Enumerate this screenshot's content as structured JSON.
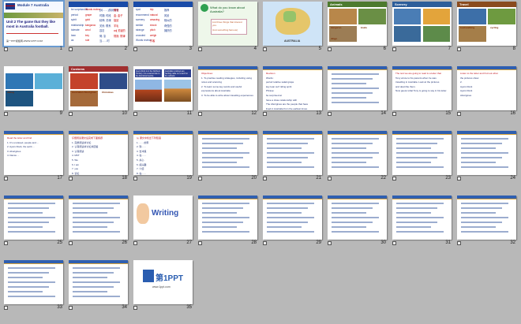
{
  "colors": {
    "background": "#b8b8b8",
    "selection": "#6a9ad0"
  },
  "slides": [
    {
      "num": "1",
      "theme": "cover",
      "title": "Unit 2  The game that they like most in Australia football.",
      "subtitle": "Module 7  Australia",
      "footer": "第一PPT模板网-WWW.1PPT.COM"
    },
    {
      "num": "2",
      "theme": "words",
      "lines": [
        "be surprised at",
        "period",
        "spirit",
        "relationship",
        "tolerate",
        "lean",
        "as",
        "Words review",
        "grape",
        "gold",
        "kangaroo",
        "wool",
        "key",
        "rule",
        "(对……)感到惊讶",
        "时期; 时段",
        "精神; 灵魂",
        "关系; 联系",
        "容忍",
        "倚; 靠",
        "当……时",
        "葡萄",
        "金; 金子",
        "袋鼠",
        "羊毛",
        "adj 关键的",
        "规则; 规律"
      ]
    },
    {
      "num": "3",
      "theme": "words",
      "lines": [
        "spot",
        "recommend",
        "scenery",
        "similar",
        "strange",
        "crowded",
        "Words review",
        "trip",
        "natural",
        "amazing",
        "shock",
        "pitch",
        "weigh",
        "作客",
        "推荐",
        "风景",
        "相似的",
        "奇怪的",
        "拥挤的"
      ]
    },
    {
      "num": "4",
      "theme": "ask",
      "lines": [
        "What do you know about Australia?",
        "List three things that interest you.",
        "(List something famous)"
      ]
    },
    {
      "num": "5",
      "theme": "map",
      "lines": [
        "AUSTRALIA"
      ]
    },
    {
      "num": "6",
      "theme": "photos",
      "lines": [
        "Animals",
        "kangaroo",
        "koala",
        "dingo"
      ]
    },
    {
      "num": "7",
      "theme": "photos",
      "lines": [
        "Scenery"
      ]
    },
    {
      "num": "8",
      "theme": "photos",
      "lines": [
        "Travel",
        "bushwalking",
        "cycling"
      ]
    },
    {
      "num": "9",
      "theme": "photos",
      "lines": [
        "surfing",
        "diving"
      ]
    },
    {
      "num": "10",
      "theme": "photos",
      "lines": [
        "Customs",
        "Australian Aborigines",
        "Christmas"
      ]
    },
    {
      "num": "11",
      "theme": "ayers",
      "lines": [
        "Ayers Rock is in the Northern Territory. It is a sacred site to the Aboriginal people.",
        "Australian cowboys are herding cattle on a ranch in the outback."
      ]
    },
    {
      "num": "12",
      "theme": "textbox",
      "lines": [
        "Objectives:",
        "1. To practise reading strategies, including using",
        "notes and scanning",
        "2. To learn some key words and useful",
        "expressions about Australia",
        "3. To be able to write about travelling experiences"
      ]
    },
    {
      "num": "13",
      "theme": "textbox",
      "lines": [
        "Revision",
        "Words:",
        "period  relative  salad  grape",
        "key   lean   surf  riding  spirit",
        "Phrase:",
        "be surprised at",
        "have a close relationship with",
        "The Aborigines are the people that have",
        "lived in Australia from the earliest times."
      ]
    },
    {
      "num": "14",
      "theme": "textbox",
      "lines": []
    },
    {
      "num": "15",
      "theme": "textbox",
      "lines": [
        "The text we are going to read is a letter that",
        "Tony wrote to his parents when he was",
        "travelling in Australia. Look at the pictures",
        "and describe them.",
        "Now guess what Tony is going to say in his letter."
      ]
    },
    {
      "num": "16",
      "theme": "textbox",
      "lines": [
        "Listen to the letter and find out what",
        "the pictures show.",
        "2.",
        "Ayers Rock",
        "Ayers Rock",
        "Aborigines"
      ]
    },
    {
      "num": "17",
      "theme": "textbox",
      "lines": [
        "Read the letter and find",
        "1. It's a relaxed, people and ...",
        "2. Ayers Rock, the spirit ...",
        "3. Aborigines",
        "4. Dance ..."
      ]
    },
    {
      "num": "18",
      "theme": "textbox",
      "lines": [
        "仔细阅读课文后完成下面各题",
        "1. 完整阅读并讨论",
        "2. 认真阅读并讨论并回答",
        "3. 认真阅读",
        "4. MKT",
        "5. We",
        "6. I am",
        "7. you",
        "8. 谈论"
      ]
    },
    {
      "num": "19",
      "theme": "textbox",
      "lines": [
        "从 课文中找出下列短语",
        "1. ……的家",
        "2. 到……",
        "3. 去冲浪",
        "4. 在……",
        "5. 关心",
        "6. 感兴趣",
        "7. 介绍",
        "8. 在……"
      ]
    },
    {
      "num": "20",
      "theme": "textbox",
      "lines": []
    },
    {
      "num": "21",
      "theme": "textbox",
      "lines": []
    },
    {
      "num": "22",
      "theme": "textbox",
      "lines": []
    },
    {
      "num": "23",
      "theme": "textbox",
      "lines": []
    },
    {
      "num": "24",
      "theme": "textbox",
      "lines": []
    },
    {
      "num": "25",
      "theme": "textbox",
      "lines": []
    },
    {
      "num": "26",
      "theme": "textbox",
      "lines": []
    },
    {
      "num": "27",
      "theme": "writing",
      "lines": [
        "Writing"
      ]
    },
    {
      "num": "28",
      "theme": "textbox",
      "lines": []
    },
    {
      "num": "29",
      "theme": "textbox",
      "lines": []
    },
    {
      "num": "30",
      "theme": "textbox",
      "lines": []
    },
    {
      "num": "31",
      "theme": "textbox",
      "lines": []
    },
    {
      "num": "32",
      "theme": "textbox",
      "lines": []
    },
    {
      "num": "33",
      "theme": "textbox",
      "lines": []
    },
    {
      "num": "34",
      "theme": "textbox",
      "lines": []
    },
    {
      "num": "35",
      "theme": "logo",
      "lines": [
        "第1PPT",
        "www.1ppt.com"
      ]
    }
  ]
}
